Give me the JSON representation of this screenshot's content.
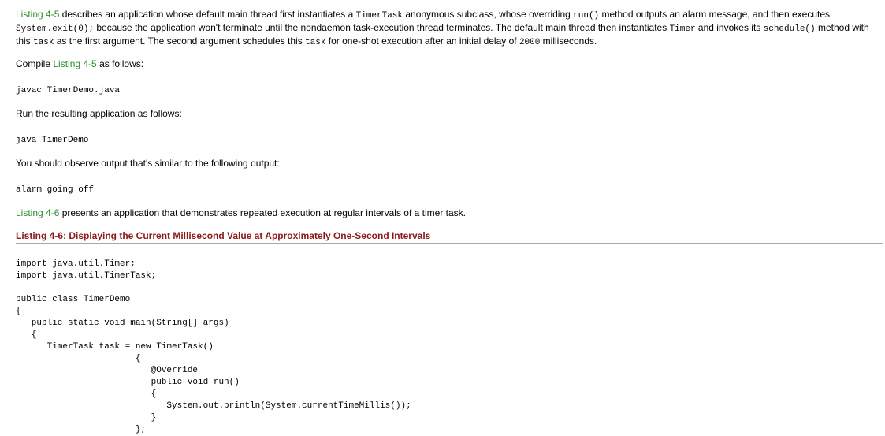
{
  "para1": {
    "ref1": "Listing 4-5",
    "t1": " describes an application whose default main thread first instantiates a ",
    "c1": "TimerTask",
    "t2": " anonymous subclass, whose overriding ",
    "c2": "run()",
    "t3": " method outputs an alarm message, and then executes ",
    "c3": "System.exit(0);",
    "t4": " because the application won't terminate until the nondaemon task-execution thread terminates. The default main thread then instantiates ",
    "c4": "Timer",
    "t5": " and invokes its ",
    "c5": "schedule()",
    "t6": " method with this ",
    "c6": "task",
    "t7": " as the first argument. The second argument schedules this ",
    "c7": "task",
    "t8": " for one-shot execution after an initial delay of ",
    "c8": "2000",
    "t9": " milliseconds."
  },
  "compile": {
    "t1": "Compile ",
    "ref": "Listing 4-5",
    "t2": " as follows:"
  },
  "compile_cmd": "javac TimerDemo.java",
  "run_text": "Run the resulting application as follows:",
  "run_cmd": "java TimerDemo",
  "observe_text": "You should observe output that's similar to the following output:",
  "output": "alarm going off",
  "para2": {
    "ref": "Listing 4-6",
    "t1": " presents an application that demonstrates repeated execution at regular intervals of a timer task."
  },
  "listing_title": "Listing 4-6: Displaying the Current Millisecond Value at Approximately One-Second Intervals",
  "code": {
    "l1": "import java.util.Timer;",
    "l2": "import java.util.TimerTask;",
    "l3": "public class TimerDemo",
    "l4": "{",
    "l5": "   public static void main(String[] args)",
    "l6": "   {",
    "l7": "      TimerTask task = new TimerTask()",
    "l8": "                       {",
    "l9": "                          @Override",
    "l10": "                          public void run()",
    "l11": "                          {",
    "l12": "                             System.out.println(System.currentTimeMillis());",
    "l13": "                          }",
    "l14": "                       };"
  }
}
